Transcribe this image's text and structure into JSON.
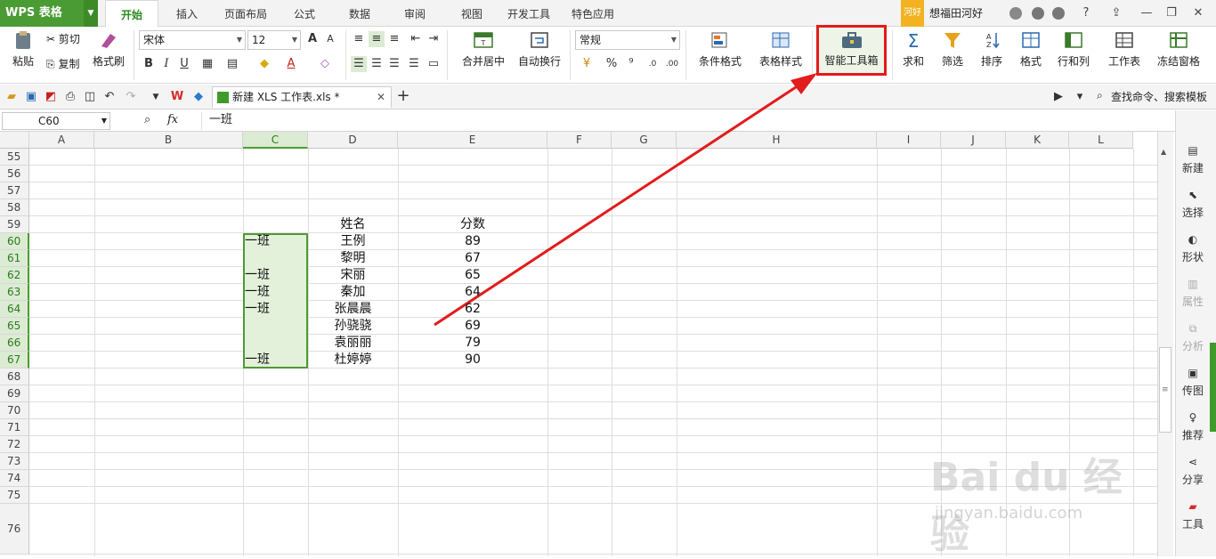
{
  "app": {
    "logo": "WPS 表格"
  },
  "menu_tabs": [
    "开始",
    "插入",
    "页面布局",
    "公式",
    "数据",
    "审阅",
    "视图",
    "开发工具",
    "特色应用"
  ],
  "user": {
    "badge": "河好",
    "name": "想福田河好"
  },
  "ribbon": {
    "paste": "粘贴",
    "cut": "剪切",
    "copy": "复制",
    "format_painter": "格式刷",
    "font_name": "宋体",
    "font_size": "12",
    "merge_center": "合并居中",
    "wrap_text": "自动换行",
    "number_format": "常规",
    "conditional_format": "条件格式",
    "table_style": "表格样式",
    "smart_toolbox": "智能工具箱",
    "sum": "求和",
    "filter": "筛选",
    "sort": "排序",
    "format": "格式",
    "row_col": "行和列",
    "worksheet": "工作表",
    "freeze": "冻结窗格",
    "percent": "%",
    "comma": "⁹"
  },
  "document_tab": {
    "title": "新建 XLS 工作表.xls *"
  },
  "search_templates": "查找命令、搜索模板",
  "formula_bar": {
    "cell_ref": "C60",
    "fx": "fx",
    "value": "一班"
  },
  "sheet": {
    "columns": [
      "A",
      "B",
      "C",
      "D",
      "E",
      "F",
      "G",
      "H",
      "I",
      "J",
      "K",
      "L"
    ],
    "rows": [
      "55",
      "56",
      "57",
      "58",
      "59",
      "60",
      "61",
      "62",
      "63",
      "64",
      "65",
      "66",
      "67",
      "68",
      "69",
      "70",
      "71",
      "72",
      "73",
      "74",
      "75",
      "76"
    ],
    "header": {
      "name": "姓名",
      "score": "分数"
    },
    "records": [
      {
        "row": "60",
        "class": "一班",
        "name": "王例",
        "score": "89"
      },
      {
        "row": "61",
        "class": "",
        "name": "黎明",
        "score": "67"
      },
      {
        "row": "62",
        "class": "一班",
        "name": "宋丽",
        "score": "65"
      },
      {
        "row": "63",
        "class": "一班",
        "name": "秦加",
        "score": "64"
      },
      {
        "row": "64",
        "class": "一班",
        "name": "张晨晨",
        "score": "62"
      },
      {
        "row": "65",
        "class": "",
        "name": "孙骁骁",
        "score": "69"
      },
      {
        "row": "66",
        "class": "",
        "name": "袁丽丽",
        "score": "79"
      },
      {
        "row": "67",
        "class": "一班",
        "name": "杜婷婷",
        "score": "90"
      }
    ]
  },
  "sidebar": [
    "新建",
    "选择",
    "形状",
    "属性",
    "分析",
    "传图",
    "推荐",
    "分享",
    "工具"
  ],
  "watermark": {
    "text": "Bai du 经验",
    "url": "jingyan.baidu.com"
  },
  "colors": {
    "brand_green": "#4a9b33",
    "highlight_red": "#e21b1b",
    "selection_fill": "#e3f1da"
  }
}
